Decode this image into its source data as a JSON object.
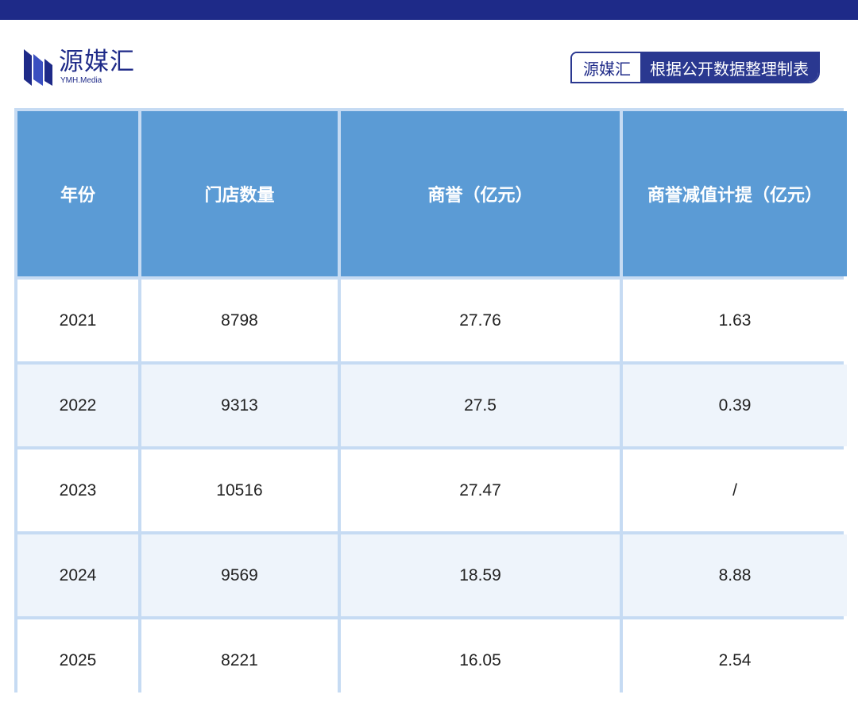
{
  "header": {
    "logo_cn": "源媒汇",
    "logo_en": "YMH.Media",
    "badge_left": "源媒汇",
    "badge_right": "根据公开数据整理制表"
  },
  "table": {
    "columns": [
      "年份",
      "门店数量",
      "商誉（亿元）",
      "商誉减值计提（亿元）"
    ],
    "rows": [
      [
        "2021",
        "8798",
        "27.76",
        "1.63"
      ],
      [
        "2022",
        "9313",
        "27.5",
        "0.39"
      ],
      [
        "2023",
        "10516",
        "27.47",
        "/"
      ],
      [
        "2024",
        "9569",
        "18.59",
        "8.88"
      ],
      [
        "2025",
        "8221",
        "16.05",
        "2.54"
      ]
    ]
  },
  "colors": {
    "brand": "#1e2a88",
    "header_bg": "#5b9bd5",
    "row_alt": "#eef4fb",
    "grid": "#c6dbf3"
  }
}
